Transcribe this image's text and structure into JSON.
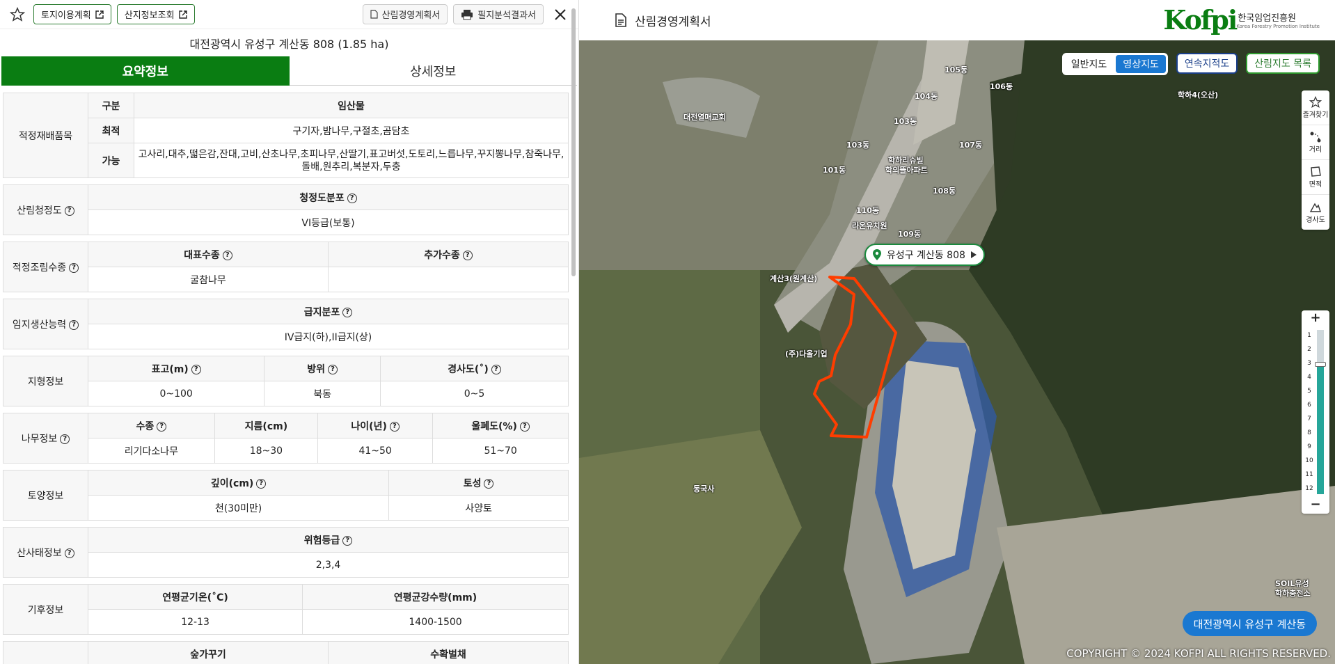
{
  "topbar": {
    "land_use_plan": "토지이용계획",
    "mountain_info": "산지정보조회",
    "forest_plan": "산림경영계획서",
    "parcel_result": "필지분석결과서"
  },
  "address": "대전광역시 유성구 계산동 808 (1.85 ha)",
  "tabs": {
    "summary": "요약정보",
    "detail": "상세정보"
  },
  "crops": {
    "label": "적정재배품목",
    "col_kind": "구분",
    "col_product": "임산물",
    "best_label": "최적",
    "best_value": "구기자,밤나무,구절초,곰담초",
    "possible_label": "가능",
    "possible_value": "고사리,대추,떫은감,잔대,고비,산초나무,초피나무,산딸기,표고버섯,도토리,느릅나무,꾸지뽕나무,참죽나무,돌배,원추리,복분자,두충"
  },
  "cleanliness": {
    "label": "산림청정도",
    "col": "청정도분포",
    "value": "VI등급(보통)"
  },
  "species": {
    "label": "적정조림수종",
    "col_main": "대표수종",
    "col_extra": "추가수종",
    "main_value": "굴참나무",
    "extra_value": ""
  },
  "productivity": {
    "label": "임지생산능력",
    "col": "급지분포",
    "value": "IV급지(하),II급지(상)"
  },
  "terrain": {
    "label": "지형정보",
    "col_elev": "표고(m)",
    "col_aspect": "방위",
    "col_slope": "경사도(˚)",
    "elev": "0~100",
    "aspect": "북동",
    "slope": "0~5"
  },
  "tree": {
    "label": "나무정보",
    "col_species": "수종",
    "col_dia": "지름(cm)",
    "col_age": "나이(년)",
    "col_density": "울폐도(%)",
    "species": "리기다소나무",
    "dia": "18~30",
    "age": "41~50",
    "density": "51~70"
  },
  "soil": {
    "label": "토양정보",
    "col_depth": "깊이(cm)",
    "col_type": "토성",
    "depth": "천(30미만)",
    "type": "사양토"
  },
  "landslide": {
    "label": "산사태정보",
    "col": "위험등급",
    "value": "2,3,4"
  },
  "climate": {
    "label": "기후정보",
    "col_temp": "연평균기온(˚C)",
    "col_rain": "연평균강수량(mm)",
    "temp": "12-13",
    "rain": "1400-1500"
  },
  "forest_row": {
    "col_a": "숲가꾸기",
    "col_b": "수확벌채"
  },
  "right": {
    "title": "산림경영계획서",
    "logo_mark": "Kofpi",
    "logo_org": "한국임업진흥원",
    "logo_sub": "Korea Forestry Promotion Institute"
  },
  "map": {
    "normal": "일반지도",
    "satellite": "영상지도",
    "cadastral": "연속지적도",
    "forest_list": "산림지도 목록",
    "tools": [
      "즐겨찾기",
      "거리",
      "면적",
      "경사도"
    ],
    "zoom_levels": [
      "1",
      "2",
      "3",
      "4",
      "5",
      "6",
      "7",
      "8",
      "9",
      "10",
      "11",
      "12"
    ],
    "zoom_current": 3,
    "marker": "유성구 계산동 808",
    "region": "대전광역시 유성구 계산동",
    "copyright": "COPYRIGHT © 2024 KOFPI ALL RIGHTS RESERVED.",
    "labels": [
      "대전열매교회",
      "105동",
      "106동",
      "104동",
      "103동",
      "107동",
      "103동",
      "101동",
      "108동",
      "110동",
      "109동",
      "학하리슈빌",
      "학의뜰아파트",
      "라온유치원",
      "계산3(원계산)",
      "(주)다올기업",
      "동국사",
      "학하4(오산)",
      "SOIL유성",
      "학하충전소"
    ]
  },
  "colors": {
    "green": "#0a7d12",
    "blue": "#1a78d1",
    "parcel": "#ff3d00"
  }
}
